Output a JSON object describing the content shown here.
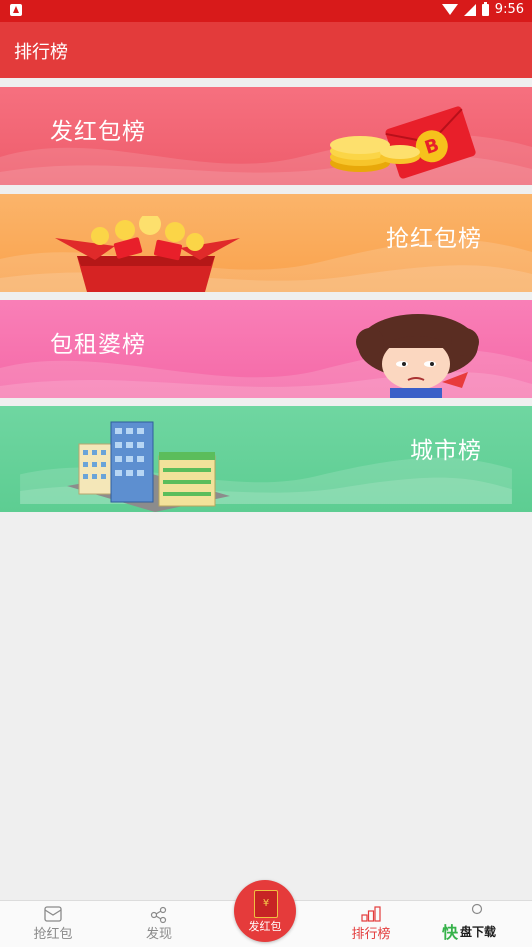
{
  "status": {
    "time": "9:56"
  },
  "appbar": {
    "title": "排行榜"
  },
  "banners": [
    {
      "label": "发红包榜"
    },
    {
      "label": "抢红包榜"
    },
    {
      "label": "包租婆榜"
    },
    {
      "label": "城市榜"
    }
  ],
  "tabs": [
    {
      "label": "抢红包"
    },
    {
      "label": "发现"
    },
    {
      "label": "发红包"
    },
    {
      "label": "排行榜"
    },
    {
      "label": ""
    }
  ],
  "watermark": {
    "brand": "快",
    "text": "盘下载"
  },
  "colors": {
    "primary": "#e33b3b",
    "statusbar": "#d81a1a"
  }
}
